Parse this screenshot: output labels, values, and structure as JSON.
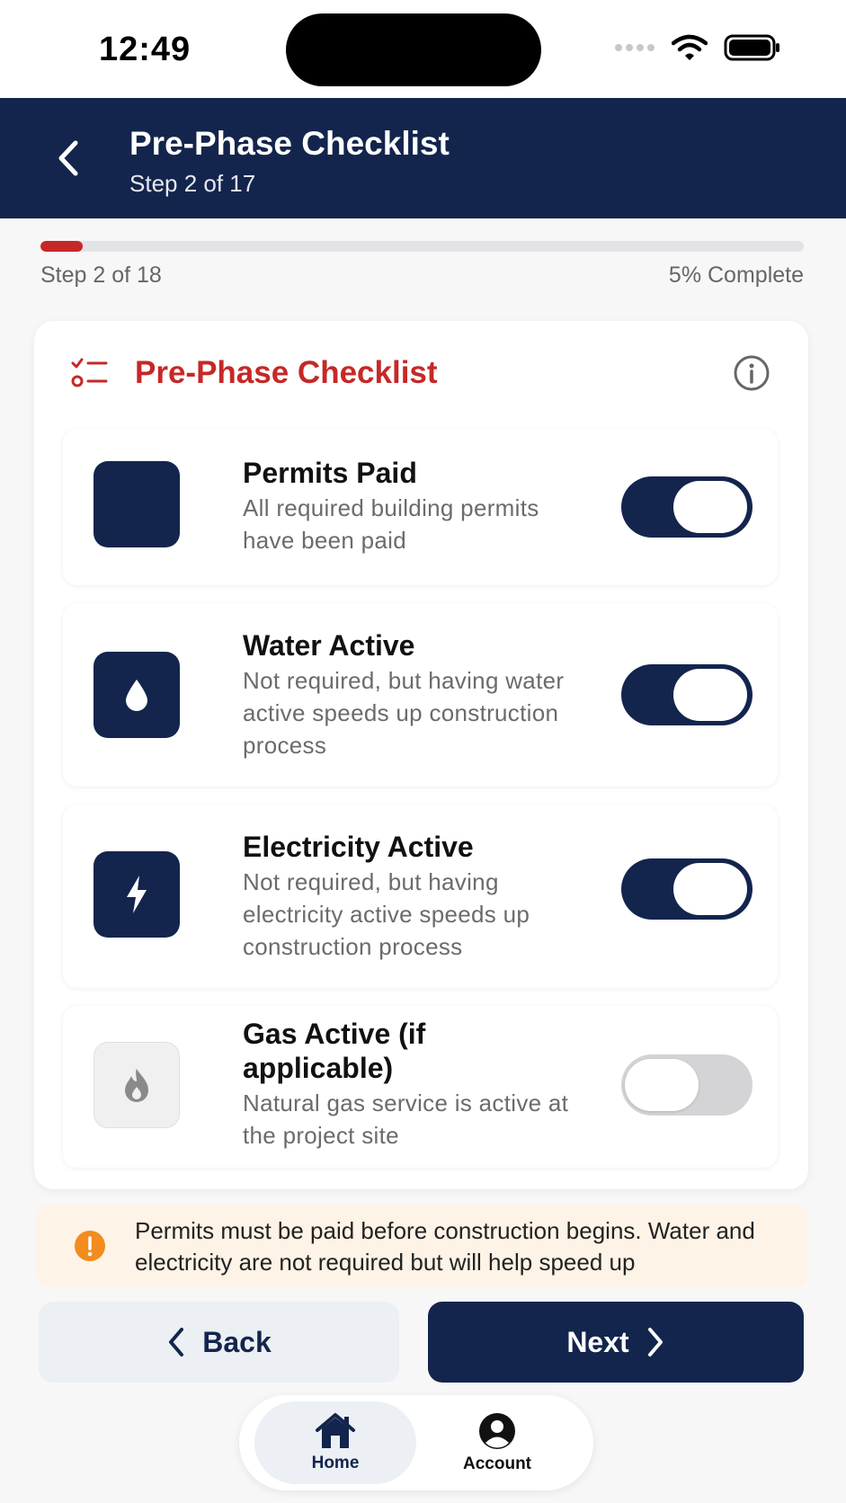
{
  "status_bar": {
    "time": "12:49"
  },
  "header": {
    "title": "Pre-Phase Checklist",
    "subtitle": "Step 2 of 17"
  },
  "progress": {
    "step_text": "Step 2 of 18",
    "percent_text": "5% Complete",
    "fill_fraction": 0.055
  },
  "card": {
    "title": "Pre-Phase Checklist",
    "items": [
      {
        "title": "Permits Paid",
        "description": "All required building permits have been paid",
        "icon": "square-icon",
        "enabled": true
      },
      {
        "title": "Water Active",
        "description": "Not required, but having water active speeds up construction process",
        "icon": "water-drop-icon",
        "enabled": true
      },
      {
        "title": "Electricity Active",
        "description": "Not required, but having electricity active speeds up construction process",
        "icon": "lightning-icon",
        "enabled": true
      },
      {
        "title": "Gas Active (if applicable)",
        "description": "Natural gas service is active at the project site",
        "icon": "flame-icon",
        "enabled": false
      }
    ]
  },
  "notice": {
    "text": "Permits must be paid before construction begins. Water and electricity are not required but will help speed up"
  },
  "buttons": {
    "back": "Back",
    "next": "Next"
  },
  "nav": {
    "home": "Home",
    "account": "Account"
  },
  "colors": {
    "primary": "#13254d",
    "accent": "#c62828",
    "warning": "#f28c1e"
  }
}
